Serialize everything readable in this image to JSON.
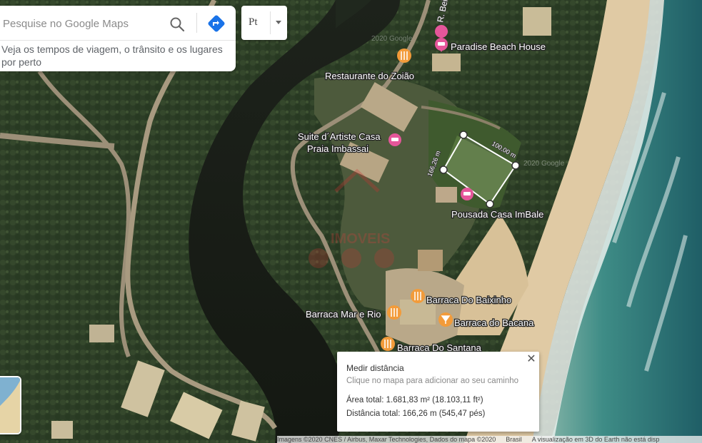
{
  "search": {
    "placeholder": "Pesquise no Google Maps",
    "hint": "Veja os tempos de viagem, o trânsito e os lugares por perto"
  },
  "toolbar": {
    "layer_label": "Pt"
  },
  "places": [
    {
      "name": "Paradise Beach House",
      "type": "lodging"
    },
    {
      "name": "Restaurante do Zoião",
      "type": "restaurant"
    },
    {
      "name": "Suite d´Artiste Casa",
      "name_line2": "Praia Imbassai",
      "type": "lodging"
    },
    {
      "name": "Pousada Casa ImBale",
      "type": "lodging"
    },
    {
      "name": "Barraca Do Baixinho",
      "type": "restaurant"
    },
    {
      "name": "Barraca Mar e Rio",
      "type": "restaurant"
    },
    {
      "name": "Barraca do Bacana",
      "type": "bar"
    },
    {
      "name": "Barraca Do Santana",
      "type": "restaurant"
    }
  ],
  "street_label": "R. Bei",
  "measure_labels": {
    "edge_a": "100,00 m",
    "edge_b": "166,26 m"
  },
  "watermarks": [
    "2020 Google",
    "2020 Google"
  ],
  "measure_card": {
    "title": "Medir distância",
    "subtitle": "Clique no mapa para adicionar ao seu caminho",
    "area": "Área total: 1.681,83 m² (18.103,11 ft²)",
    "distance": "Distância total: 166,26 m (545,47 pés)"
  },
  "footer": {
    "imagery": "Imagens ©2020 CNES / Airbus, Maxar Technologies, Dados do mapa ©2020",
    "country": "Brasil",
    "notice": "A visualização em 3D do Earth não está disp"
  },
  "colors": {
    "restaurant": "#f29b3a",
    "lodging": "#e5569a",
    "directions": "#1a73e8",
    "measure_line": "#ffffff"
  }
}
